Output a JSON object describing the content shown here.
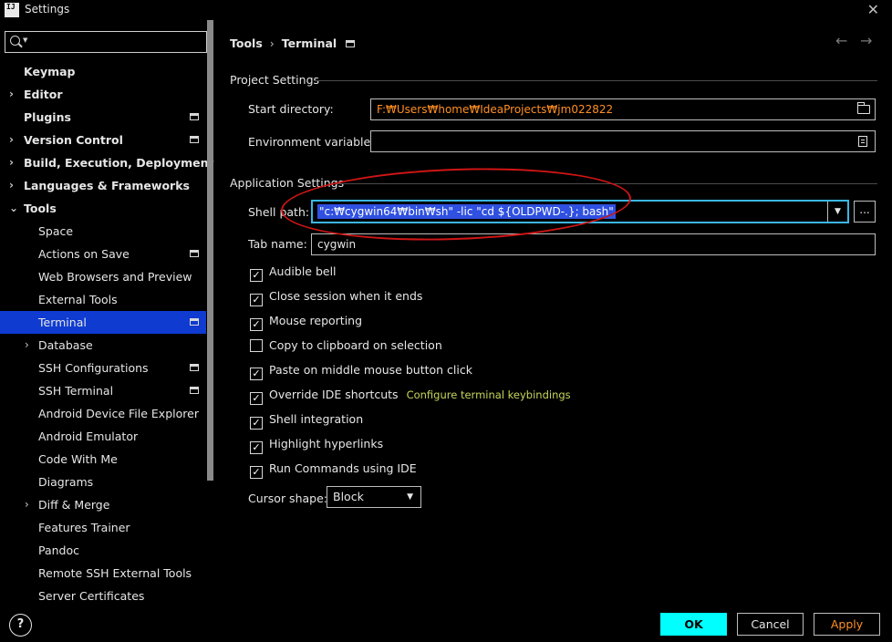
{
  "window": {
    "title": "Settings",
    "logo_text": "IJ"
  },
  "search": {
    "value": "",
    "placeholder": ""
  },
  "sidebar": {
    "items": [
      {
        "label": "Keymap",
        "chevron": ""
      },
      {
        "label": "Editor",
        "chevron": "›"
      },
      {
        "label": "Plugins",
        "chevron": ""
      },
      {
        "label": "Version Control",
        "chevron": "›"
      },
      {
        "label": "Build, Execution, Deployment",
        "chevron": "›"
      },
      {
        "label": "Languages & Frameworks",
        "chevron": "›"
      },
      {
        "label": "Tools",
        "chevron": "⌄"
      },
      {
        "label": "Space",
        "chevron": ""
      },
      {
        "label": "Actions on Save",
        "chevron": ""
      },
      {
        "label": "Web Browsers and Preview",
        "chevron": ""
      },
      {
        "label": "External Tools",
        "chevron": ""
      },
      {
        "label": "Terminal",
        "chevron": ""
      },
      {
        "label": "Database",
        "chevron": "›"
      },
      {
        "label": "SSH Configurations",
        "chevron": ""
      },
      {
        "label": "SSH Terminal",
        "chevron": ""
      },
      {
        "label": "Android Device File Explorer",
        "chevron": ""
      },
      {
        "label": "Android Emulator",
        "chevron": ""
      },
      {
        "label": "Code With Me",
        "chevron": ""
      },
      {
        "label": "Diagrams",
        "chevron": ""
      },
      {
        "label": "Diff & Merge",
        "chevron": "›"
      },
      {
        "label": "Features Trainer",
        "chevron": ""
      },
      {
        "label": "Pandoc",
        "chevron": ""
      },
      {
        "label": "Remote SSH External Tools",
        "chevron": ""
      },
      {
        "label": "Server Certificates",
        "chevron": ""
      }
    ]
  },
  "breadcrumb": {
    "parent": "Tools",
    "separator": "›",
    "current": "Terminal"
  },
  "nav": {
    "back": "←",
    "forward": "→"
  },
  "project_settings": {
    "title": "Project Settings",
    "start_dir_label": "Start directory:",
    "start_dir_value": "F:₩Users₩home₩IdeaProjects₩jm022822",
    "env_vars_label": "Environment variables:",
    "env_vars_value": ""
  },
  "app_settings": {
    "title": "Application Settings",
    "shell_path_label": "Shell path:",
    "shell_path_value": "\"c:₩cygwin64₩bin₩sh\" -lic \"cd ${OLDPWD-.}; bash\"",
    "browse_label": "...",
    "tab_name_label": "Tab name:",
    "tab_name_value": "cygwin",
    "dropdown_glyph": "▼"
  },
  "checkboxes": [
    {
      "label": "Audible bell",
      "checked": true
    },
    {
      "label": "Close session when it ends",
      "checked": true
    },
    {
      "label": "Mouse reporting",
      "checked": true
    },
    {
      "label": "Copy to clipboard on selection",
      "checked": false
    },
    {
      "label": "Paste on middle mouse button click",
      "checked": true
    },
    {
      "label": "Override IDE shortcuts",
      "checked": true
    },
    {
      "label": "Shell integration",
      "checked": true
    },
    {
      "label": "Highlight hyperlinks",
      "checked": true
    },
    {
      "label": "Run Commands using IDE",
      "checked": true
    }
  ],
  "configure_link": "Configure terminal keybindings",
  "cursor": {
    "label": "Cursor shape:",
    "value": "Block"
  },
  "footer": {
    "help": "?",
    "ok": "OK",
    "cancel": "Cancel",
    "apply": "Apply"
  },
  "glyphs": {
    "check": "✓",
    "close": "✕"
  }
}
